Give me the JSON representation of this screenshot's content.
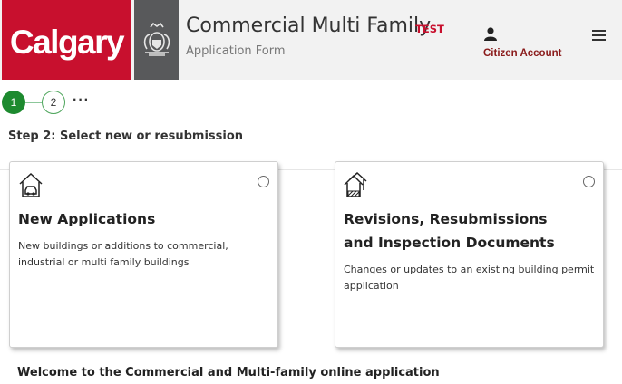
{
  "header": {
    "logo_text": "Calgary",
    "title": "Commercial Multi Family",
    "badge": "TEST",
    "subtitle": "Application Form",
    "account_label": "Citizen Account",
    "account_icon": "user-icon",
    "menu_icon": "hamburger-menu-icon",
    "brand_color": "#c8102e"
  },
  "stepper": {
    "steps": [
      "1",
      "2"
    ],
    "more": "···",
    "active_color": "#1d8a2f"
  },
  "step_heading": "Step 2: Select new or resubmission",
  "cards": [
    {
      "icon": "house-car-icon",
      "title": "New Applications",
      "description": "New buildings or additions to commercial, industrial or multi family buildings",
      "selected": false
    },
    {
      "icon": "house-revision-icon",
      "title": "Revisions, Resubmissions and Inspection Documents",
      "description": "Changes or updates to an existing building permit application",
      "selected": false
    }
  ],
  "welcome_text": "Welcome to the Commercial and Multi-family online application"
}
